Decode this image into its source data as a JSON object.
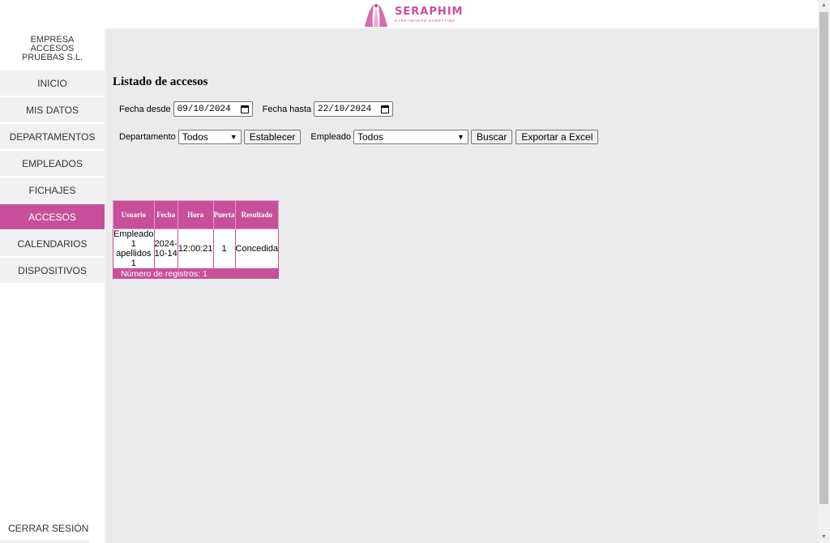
{
  "header": {
    "brand": "SERAPHIM",
    "tagline": "EVERYWHERE EVERYTIME"
  },
  "sidebar": {
    "company_lines": [
      "EMPRESA",
      "ACCESOS",
      "PRUEBAS S.L."
    ],
    "items": [
      {
        "label": "INICIO"
      },
      {
        "label": "MIS DATOS"
      },
      {
        "label": "DEPARTAMENTOS"
      },
      {
        "label": "EMPLEADOS"
      },
      {
        "label": "FICHAJES"
      },
      {
        "label": "ACCESOS"
      },
      {
        "label": "CALENDARIOS"
      },
      {
        "label": "DISPOSITIVOS"
      }
    ],
    "logout": "CERRAR SESIÓN"
  },
  "main": {
    "title": "Listado de accesos",
    "filters": {
      "date_from_label": "Fecha desde",
      "date_from_value": "09/10/2024",
      "date_to_label": "Fecha hasta",
      "date_to_value": "22/10/2024",
      "department_label": "Departamento",
      "department_value": "Todos",
      "set_button": "Establecer",
      "employee_label": "Empleado",
      "employee_value": "Todos",
      "search_button": "Buscar",
      "export_button": "Exportar a Excel"
    },
    "table": {
      "columns": [
        "Usuario",
        "Fecha",
        "Hora",
        "Puerta",
        "Resultado"
      ],
      "rows": [
        [
          "Empleado 1 apellidos 1",
          "2024-10-14",
          "12:00:21",
          "1",
          "Concedida"
        ]
      ],
      "footer": "Número de registros: 1"
    }
  },
  "colors": {
    "accent": "#c8509b",
    "sidebar_item_bg": "#f1f1f1",
    "content_bg": "#ebebeb"
  }
}
